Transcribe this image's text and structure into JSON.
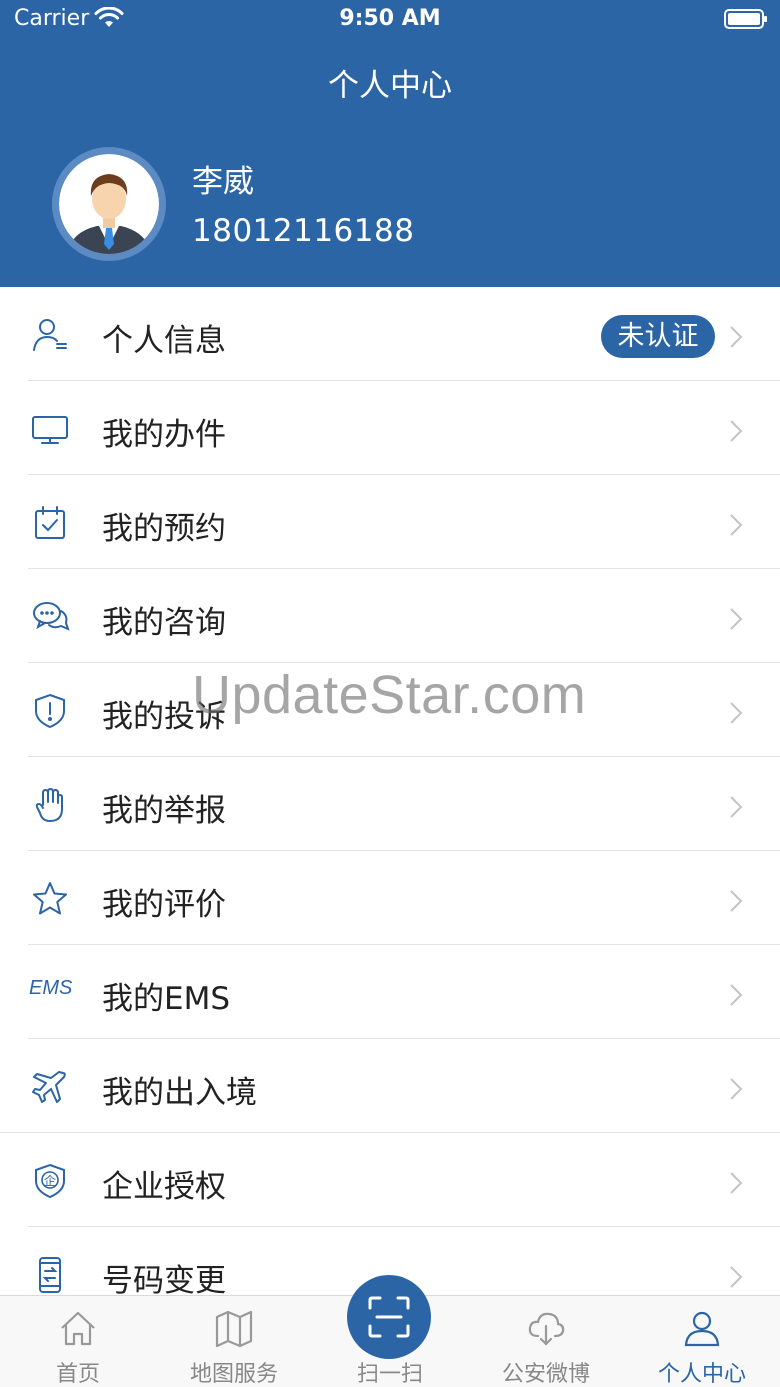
{
  "status_bar": {
    "carrier": "Carrier",
    "time": "9:50 AM"
  },
  "header": {
    "title": "个人中心"
  },
  "profile": {
    "name": "李威",
    "phone": "18012116188"
  },
  "menu": {
    "items": [
      {
        "label": "个人信息",
        "icon": "person-icon",
        "badge": "未认证"
      },
      {
        "label": "我的办件",
        "icon": "monitor-icon"
      },
      {
        "label": "我的预约",
        "icon": "calendar-check-icon"
      },
      {
        "label": "我的咨询",
        "icon": "chat-bubbles-icon"
      },
      {
        "label": "我的投诉",
        "icon": "shield-exclamation-icon"
      },
      {
        "label": "我的举报",
        "icon": "hand-icon"
      },
      {
        "label": "我的评价",
        "icon": "star-icon"
      },
      {
        "label": "我的EMS",
        "icon": "ems-text-icon",
        "icon_text": "EMS"
      },
      {
        "label": "我的出入境",
        "icon": "airplane-icon"
      },
      {
        "label": "企业授权",
        "icon": "enterprise-shield-icon",
        "icon_text": "企"
      },
      {
        "label": "号码变更",
        "icon": "phone-swap-icon"
      }
    ]
  },
  "watermark": "UpdateStar.com",
  "tabbar": {
    "tabs": [
      {
        "label": "首页",
        "icon": "home-icon"
      },
      {
        "label": "地图服务",
        "icon": "map-icon"
      },
      {
        "label": "扫一扫",
        "icon": "scan-icon"
      },
      {
        "label": "公安微博",
        "icon": "cloud-icon"
      },
      {
        "label": "个人中心",
        "icon": "person-icon",
        "active": true
      }
    ]
  },
  "colors": {
    "primary": "#2c65a6",
    "tab_inactive": "#888888",
    "divider": "#e4e4e4"
  }
}
